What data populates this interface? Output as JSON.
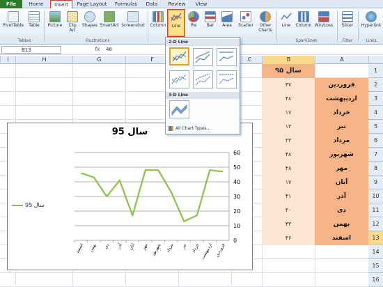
{
  "tabs": {
    "file": "File",
    "home": "Home",
    "insert": "Insert",
    "page_layout": "Page Layout",
    "formulas": "Formulas",
    "data": "Data",
    "review": "Review",
    "view": "View"
  },
  "ribbon": {
    "pivottable": "PivotTable",
    "table": "Table",
    "picture": "Picture",
    "clipart": "Clip Art",
    "shapes": "Shapes",
    "smartart": "SmartArt",
    "screenshot": "Screenshot",
    "column": "Column",
    "line": "Line",
    "pie": "Pie",
    "bar": "Bar",
    "area": "Area",
    "scatter": "Scatter",
    "other_charts": "Other Charts",
    "spark_line": "Line",
    "spark_column": "Column",
    "spark_winloss": "Win/Loss",
    "slicer": "Slicer",
    "hyperlink": "Hyperlink",
    "groups": {
      "tables": "Tables",
      "illustrations": "Illustrations",
      "sparklines": "Sparklines",
      "filter": "Filter",
      "links": "Links"
    }
  },
  "formula_bar": {
    "name_box": "B13",
    "fx": "fx",
    "value": "46"
  },
  "columns": [
    "I",
    "H",
    "G",
    "F",
    "E",
    "D",
    "C",
    "B",
    "A"
  ],
  "rows": [
    "1",
    "2",
    "3",
    "4",
    "5",
    "6",
    "7",
    "8",
    "9",
    "10",
    "11",
    "12",
    "13",
    "14",
    "15",
    "16"
  ],
  "sheet": {
    "b1_header": "سال ۹۵",
    "months": [
      "فروردین",
      "اردیبهشت",
      "خرداد",
      "تیر",
      "مرداد",
      "شهریور",
      "مهر",
      "آبان",
      "آذر",
      "دی",
      "بهمن",
      "اسفند"
    ],
    "values": [
      "۴۷",
      "۴۸",
      "۱۷",
      "۱۳",
      "۳۳",
      "۴۸",
      "۴۸",
      "۱۷",
      "۴۱",
      "۳۰",
      "۴۳",
      "۴۶"
    ]
  },
  "dropdown": {
    "section_2d": "2-D Line",
    "section_3d": "3-D Line",
    "all_chart_types": "All Chart Types..."
  },
  "chart_data": {
    "type": "line",
    "title": "سال 95",
    "categories": [
      "اسفند",
      "بهمن",
      "دی",
      "آذر",
      "آبان",
      "مهر",
      "شهریور",
      "مرداد",
      "تیر",
      "خرداد",
      "اردیبهشت",
      "فروردین"
    ],
    "series": [
      {
        "name": "سال 95",
        "values": [
          46,
          43,
          30,
          41,
          17,
          48,
          48,
          33,
          13,
          17,
          48,
          47
        ]
      }
    ],
    "ylim": [
      0,
      60
    ],
    "yticks": [
      0,
      10,
      20,
      30,
      40,
      50,
      60
    ],
    "grid": true,
    "legend": "left",
    "color": "#8fbf4a"
  }
}
